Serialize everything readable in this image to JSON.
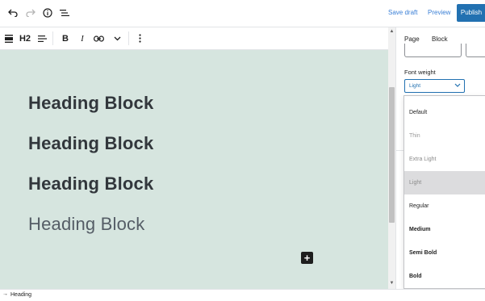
{
  "topbar": {
    "icons": [
      "undo-icon",
      "redo-icon",
      "info-icon",
      "list-view-icon"
    ],
    "save_draft": "Save draft",
    "preview": "Preview",
    "publish": "Publish"
  },
  "block_toolbar": {
    "heading_level": "H2",
    "bold": "B",
    "italic": "I"
  },
  "canvas": {
    "background": "#d6e5df",
    "headings": [
      {
        "text": "Heading Block",
        "weight": "900"
      },
      {
        "text": "Heading Block",
        "weight": "700"
      },
      {
        "text": "Heading Block",
        "weight": "600"
      },
      {
        "text": "Heading Block",
        "weight": "300"
      }
    ],
    "add_block": "+"
  },
  "sidebar": {
    "tabs": [
      {
        "label": "Page",
        "active": false
      },
      {
        "label": "Block",
        "active": true
      }
    ],
    "font_weight_label": "Font weight",
    "font_weight_value": "Light"
  },
  "dropdown": {
    "options": [
      {
        "label": "Default",
        "weight": "400",
        "color": "#1e1e1e",
        "selected": false
      },
      {
        "label": "Thin",
        "weight": "100",
        "color": "#8a8a8a",
        "selected": false
      },
      {
        "label": "Extra Light",
        "weight": "200",
        "color": "#8a8a8a",
        "selected": false
      },
      {
        "label": "Light",
        "weight": "300",
        "color": "#8a8a8a",
        "selected": true
      },
      {
        "label": "Regular",
        "weight": "400",
        "color": "#1e1e1e",
        "selected": false
      },
      {
        "label": "Medium",
        "weight": "500",
        "color": "#1e1e1e",
        "selected": false
      },
      {
        "label": "Semi Bold",
        "weight": "600",
        "color": "#1e1e1e",
        "selected": false
      },
      {
        "label": "Bold",
        "weight": "700",
        "color": "#1e1e1e",
        "selected": false
      }
    ]
  },
  "statusbar": {
    "breadcrumb": "Heading"
  },
  "colors": {
    "accent": "#2271b1",
    "link": "#3a7fd6",
    "canvas": "#d6e5df",
    "heading_text": "#32373c"
  }
}
